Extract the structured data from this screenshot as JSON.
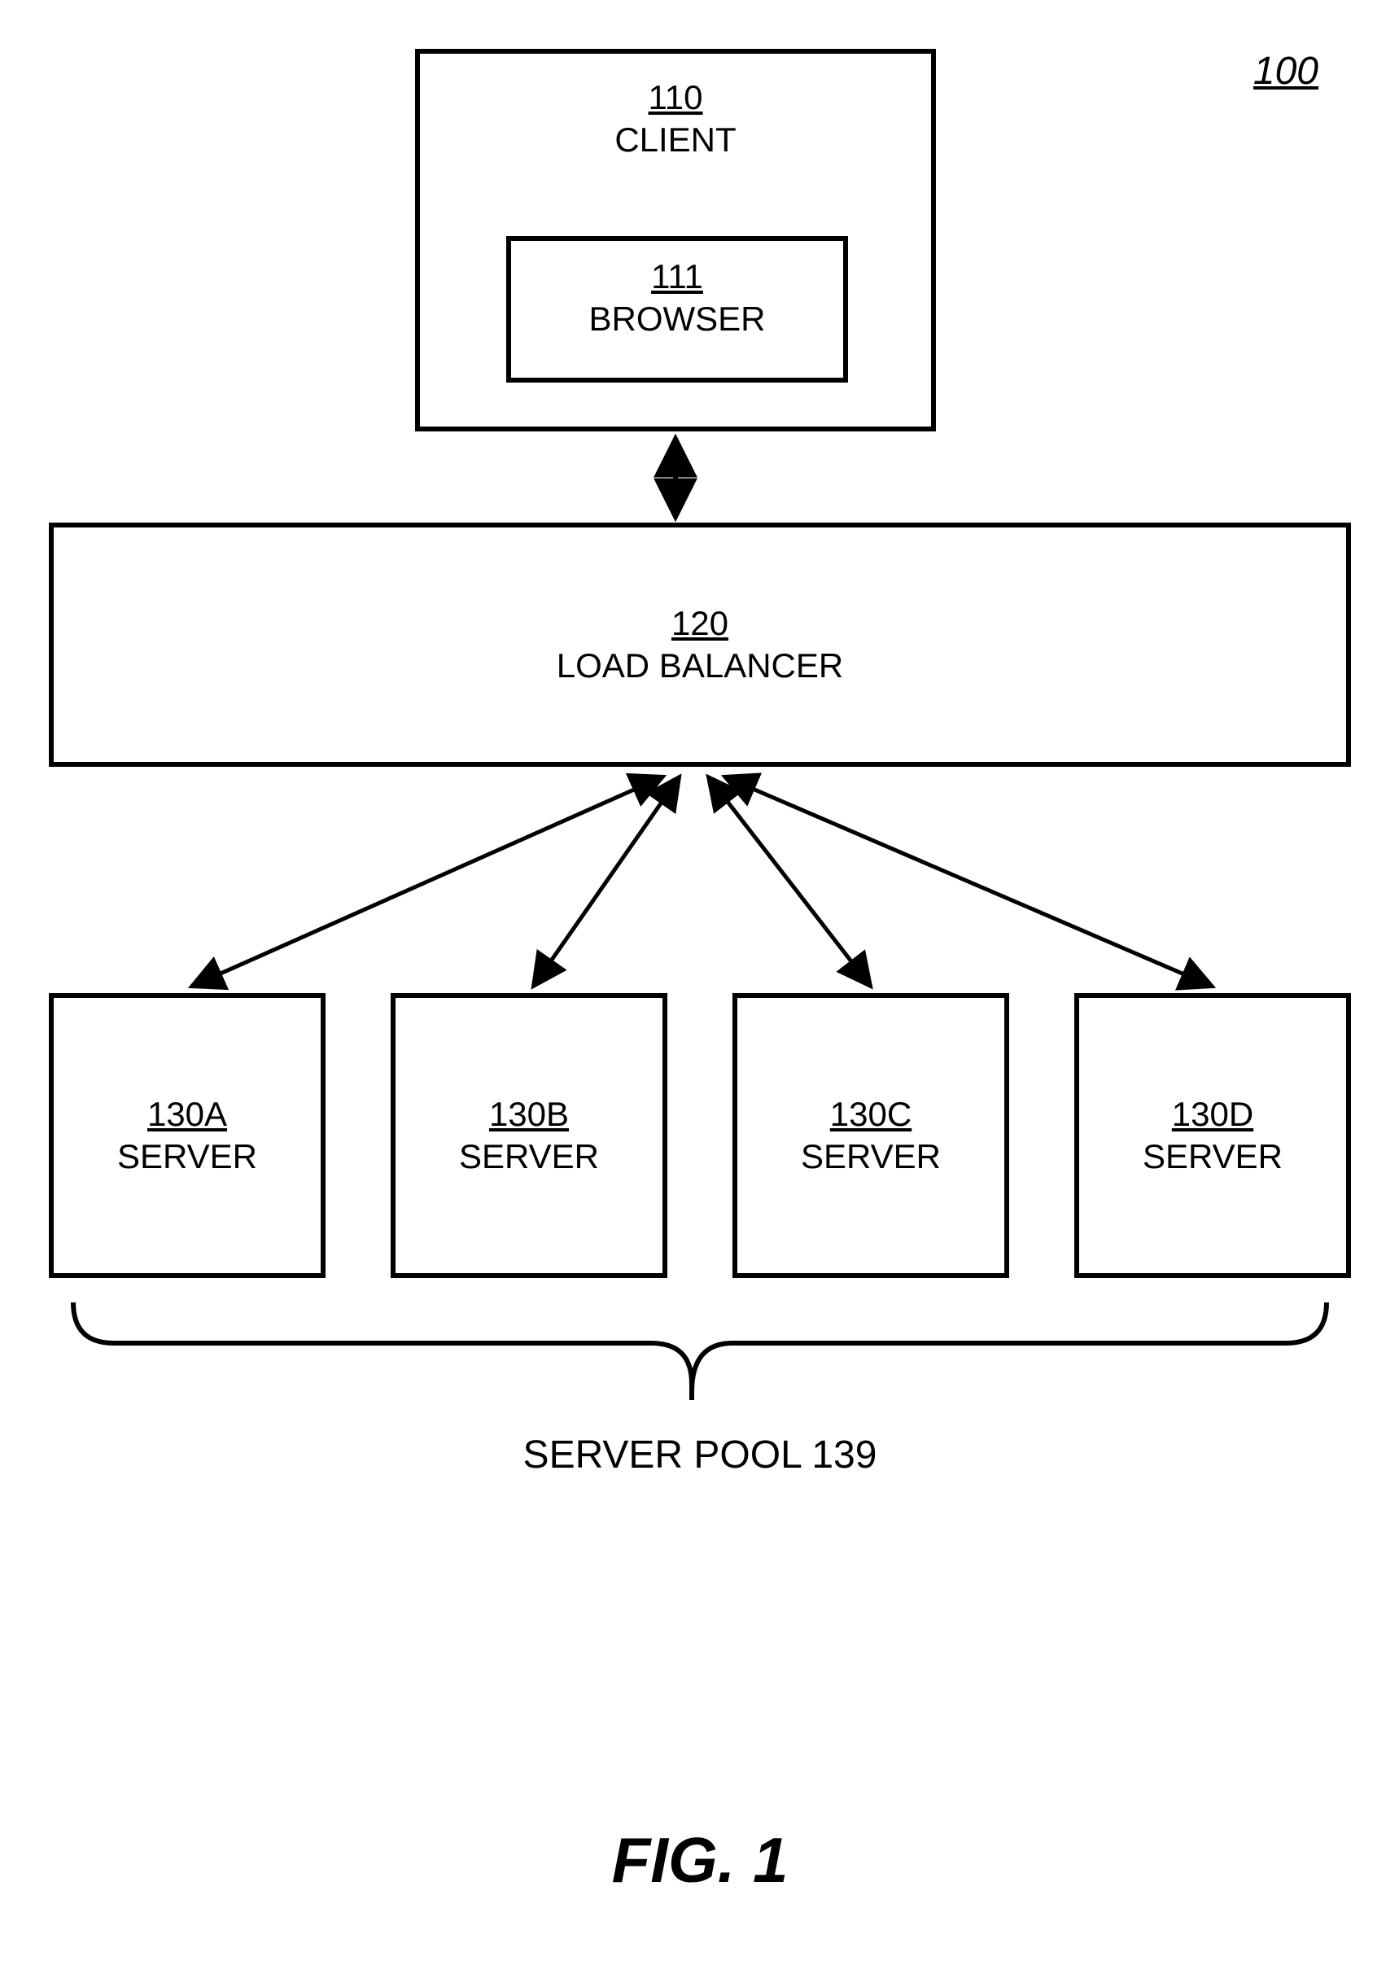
{
  "ref": "100",
  "client": {
    "num": "110",
    "label": "CLIENT"
  },
  "browser": {
    "num": "111",
    "label": "BROWSER"
  },
  "lb": {
    "num": "120",
    "label": "LOAD BALANCER"
  },
  "servers": {
    "a": {
      "num": "130A",
      "label": "SERVER"
    },
    "b": {
      "num": "130B",
      "label": "SERVER"
    },
    "c": {
      "num": "130C",
      "label": "SERVER"
    },
    "d": {
      "num": "130D",
      "label": "SERVER"
    }
  },
  "pool": "SERVER POOL 139",
  "figure": "FIG. 1"
}
